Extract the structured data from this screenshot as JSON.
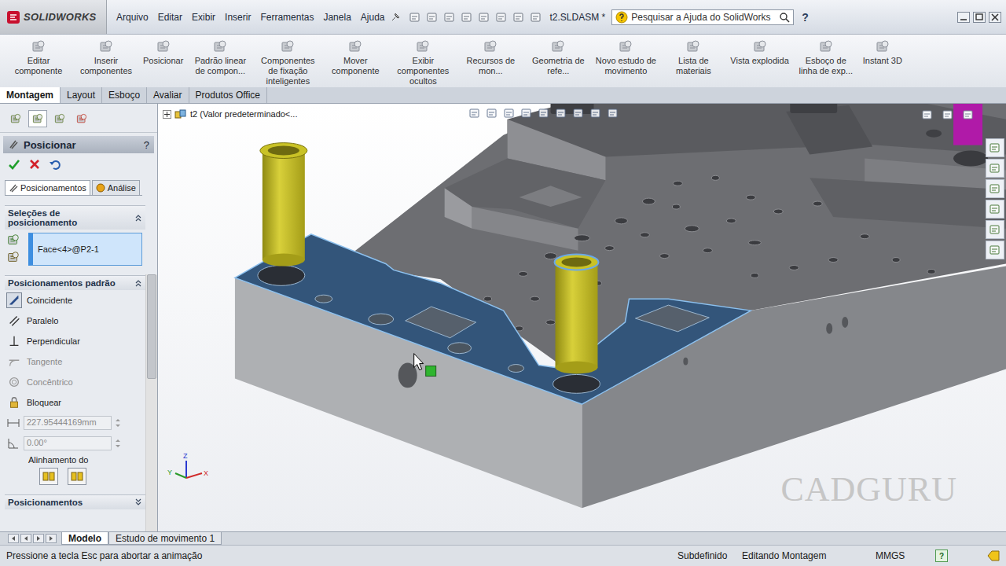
{
  "app": {
    "logo": "SOLIDWORKS"
  },
  "window": {
    "title": "t2.SLDASM *"
  },
  "menu": [
    "Arquivo",
    "Editar",
    "Exibir",
    "Inserir",
    "Ferramentas",
    "Janela",
    "Ajuda"
  ],
  "search": {
    "placeholder": "Pesquisar a Ajuda do SolidWorks"
  },
  "help": "?",
  "commands": [
    "Editar componente",
    "Inserir componentes",
    "Posicionar",
    "Padrão linear de compon...",
    "Componentes de fixação inteligentes",
    "Mover componente",
    "Exibir componentes ocultos",
    "Recursos de mon...",
    "Geometria de refe...",
    "Novo estudo de movimento",
    "Lista de materiais",
    "Vista explodida",
    "Esboço de linha de exp...",
    "Instant 3D"
  ],
  "command_tabs": [
    {
      "label": "Montagem",
      "selected": true
    },
    {
      "label": "Layout",
      "selected": false
    },
    {
      "label": "Esboço",
      "selected": false
    },
    {
      "label": "Avaliar",
      "selected": false
    },
    {
      "label": "Produtos Office",
      "selected": false
    }
  ],
  "property_manager": {
    "title": "Posicionar",
    "help": "?",
    "tabs": [
      {
        "label": "Posicionamentos",
        "selected": true
      },
      {
        "label": "Análise",
        "selected": false
      }
    ],
    "selections": {
      "title": "Seleções de posicionamento",
      "expanded": true,
      "items": [
        "Face<4>@P2-1"
      ]
    },
    "standard": {
      "title": "Posicionamentos padrão",
      "expanded": true,
      "mates": [
        {
          "label": "Coincidente",
          "selected": true,
          "disabled": false
        },
        {
          "label": "Paralelo",
          "selected": false,
          "disabled": false
        },
        {
          "label": "Perpendicular",
          "selected": false,
          "disabled": false
        },
        {
          "label": "Tangente",
          "selected": false,
          "disabled": true
        },
        {
          "label": "Concêntrico",
          "selected": false,
          "disabled": true
        },
        {
          "label": "Bloquear",
          "selected": false,
          "disabled": false
        }
      ]
    },
    "distance": {
      "value": "227.95444169mm",
      "disabled": true
    },
    "angle": {
      "value": "0.00°",
      "disabled": true
    },
    "alignment_label": "Alinhamento do",
    "collapsed_section": {
      "title": "Posicionamentos",
      "expanded": false
    },
    "scrollbar": {
      "level": 0.4
    }
  },
  "tree": {
    "root": "t2  (Valor predeterminado<...",
    "expanded": false
  },
  "triad": {
    "x": "X",
    "y": "Y",
    "z": "Z"
  },
  "watermark": "CADGURU",
  "model_tabs": [
    {
      "label": "Modelo",
      "selected": true
    },
    {
      "label": "Estudo de movimento 1",
      "selected": false
    }
  ],
  "status_bar": {
    "message": "Pressione a tecla Esc para abortar a animação",
    "state": "Subdefinido",
    "mode": "Editando Montagem",
    "units": "MMGS",
    "help": "?"
  }
}
